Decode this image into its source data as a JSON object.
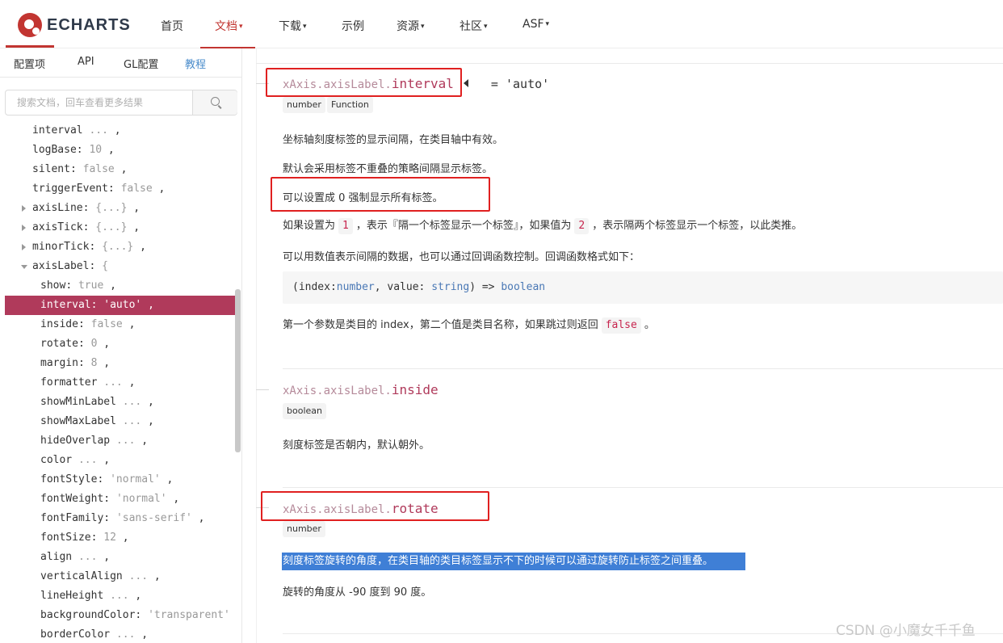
{
  "brand": {
    "logo_text": "ECHARTS"
  },
  "nav": {
    "items": [
      {
        "label": "首页",
        "caret": ""
      },
      {
        "label": "文档",
        "caret": "▾"
      },
      {
        "label": "下载",
        "caret": "▾"
      },
      {
        "label": "示例",
        "caret": ""
      },
      {
        "label": "资源",
        "caret": "▾"
      },
      {
        "label": "社区",
        "caret": "▾"
      },
      {
        "label": "ASF",
        "caret": "▾"
      }
    ],
    "active_index": 1,
    "accent": "#c23531"
  },
  "sidebar": {
    "tabs": [
      "配置项",
      "API",
      "GL配置",
      "教程"
    ],
    "search_placeholder": "搜索文档，回车查看更多结果",
    "tree": [
      {
        "key": "interval",
        "sep": " ",
        "val": "...",
        "tail": " ,"
      },
      {
        "key": "logBase",
        "sep": ": ",
        "val": "10",
        "tail": " ,"
      },
      {
        "key": "silent",
        "sep": ": ",
        "val": "false",
        "tail": " ,"
      },
      {
        "key": "triggerEvent",
        "sep": ": ",
        "val": "false",
        "tail": " ,"
      },
      {
        "key": "axisLine",
        "sep": ": ",
        "val": "{...}",
        "tail": " ,",
        "arrow": "right"
      },
      {
        "key": "axisTick",
        "sep": ": ",
        "val": "{...}",
        "tail": " ,",
        "arrow": "right"
      },
      {
        "key": "minorTick",
        "sep": ": ",
        "val": "{...}",
        "tail": " ,",
        "arrow": "right"
      },
      {
        "key": "axisLabel",
        "sep": ": ",
        "val": "{",
        "tail": "",
        "arrow": "down"
      },
      {
        "key": "show",
        "sep": ": ",
        "val": "true",
        "tail": " ,",
        "indent": true
      },
      {
        "key": "interval",
        "sep": ": ",
        "val": "'auto'",
        "tail": " ,",
        "indent": true,
        "selected": true
      },
      {
        "key": "inside",
        "sep": ": ",
        "val": "false",
        "tail": " ,",
        "indent": true
      },
      {
        "key": "rotate",
        "sep": ": ",
        "val": "0",
        "tail": " ,",
        "indent": true
      },
      {
        "key": "margin",
        "sep": ": ",
        "val": "8",
        "tail": " ,",
        "indent": true
      },
      {
        "key": "formatter",
        "sep": " ",
        "val": "...",
        "tail": " ,",
        "indent": true
      },
      {
        "key": "showMinLabel",
        "sep": " ",
        "val": "...",
        "tail": " ,",
        "indent": true
      },
      {
        "key": "showMaxLabel",
        "sep": " ",
        "val": "...",
        "tail": " ,",
        "indent": true
      },
      {
        "key": "hideOverlap",
        "sep": " ",
        "val": "...",
        "tail": " ,",
        "indent": true
      },
      {
        "key": "color",
        "sep": " ",
        "val": "...",
        "tail": " ,",
        "indent": true
      },
      {
        "key": "fontStyle",
        "sep": ": ",
        "val": "'normal'",
        "tail": " ,",
        "indent": true
      },
      {
        "key": "fontWeight",
        "sep": ": ",
        "val": "'normal'",
        "tail": " ,",
        "indent": true
      },
      {
        "key": "fontFamily",
        "sep": ": ",
        "val": "'sans-serif'",
        "tail": " ,",
        "indent": true
      },
      {
        "key": "fontSize",
        "sep": ": ",
        "val": "12",
        "tail": " ,",
        "indent": true
      },
      {
        "key": "align",
        "sep": " ",
        "val": "...",
        "tail": " ,",
        "indent": true
      },
      {
        "key": "verticalAlign",
        "sep": " ",
        "val": "...",
        "tail": " ,",
        "indent": true
      },
      {
        "key": "lineHeight",
        "sep": " ",
        "val": "...",
        "tail": " ,",
        "indent": true
      },
      {
        "key": "backgroundColor",
        "sep": ": ",
        "val": "'transparent'",
        "tail": "",
        "indent": true
      },
      {
        "key": "borderColor",
        "sep": " ",
        "val": "...",
        "tail": " ,",
        "indent": true
      }
    ],
    "selected_color": "#b03a5b"
  },
  "content": {
    "interval": {
      "prefix": "xAxis.axisLabel.",
      "name": "interval",
      "default": "= 'auto'",
      "types": [
        "number",
        "Function"
      ],
      "p1": "坐标轴刻度标签的显示间隔，在类目轴中有效。",
      "p2": "默认会采用标签不重叠的策略间隔显示标签。",
      "p3": "可以设置成 0 强制显示所有标签。",
      "p4_a": "如果设置为",
      "p4_code1": "1",
      "p4_b": "，表示『隔一个标签显示一个标签』，如果值为",
      "p4_code2": "2",
      "p4_c": "，表示隔两个标签显示一个标签，以此类推。",
      "p5": "可以用数值表示间隔的数据，也可以通过回调函数控制。回调函数格式如下：",
      "code": {
        "open": "(index:",
        "t1": "number",
        "mid": ", value: ",
        "t2": "string",
        "close": ") => ",
        "t3": "boolean"
      },
      "p6_a": "第一个参数是类目的 index，第二个值是类目名称，如果跳过则返回",
      "p6_code": "false",
      "p6_b": "。"
    },
    "inside": {
      "prefix": "xAxis.axisLabel.",
      "name": "inside",
      "types": [
        "boolean"
      ],
      "p1": "刻度标签是否朝内，默认朝外。"
    },
    "rotate": {
      "prefix": "xAxis.axisLabel.",
      "name": "rotate",
      "types": [
        "number"
      ],
      "p1": "刻度标签旋转的角度，在类目轴的类目标签显示不下的时候可以通过旋转防止标签之间重叠。",
      "p2": "旋转的角度从 -90 度到 90 度。"
    }
  },
  "watermark": "CSDN @小魔女千千鱼",
  "colors": {
    "annotation_red": "#e02020",
    "highlight_blue": "#3f7fd6",
    "link_blue": "#4a8ccb"
  }
}
